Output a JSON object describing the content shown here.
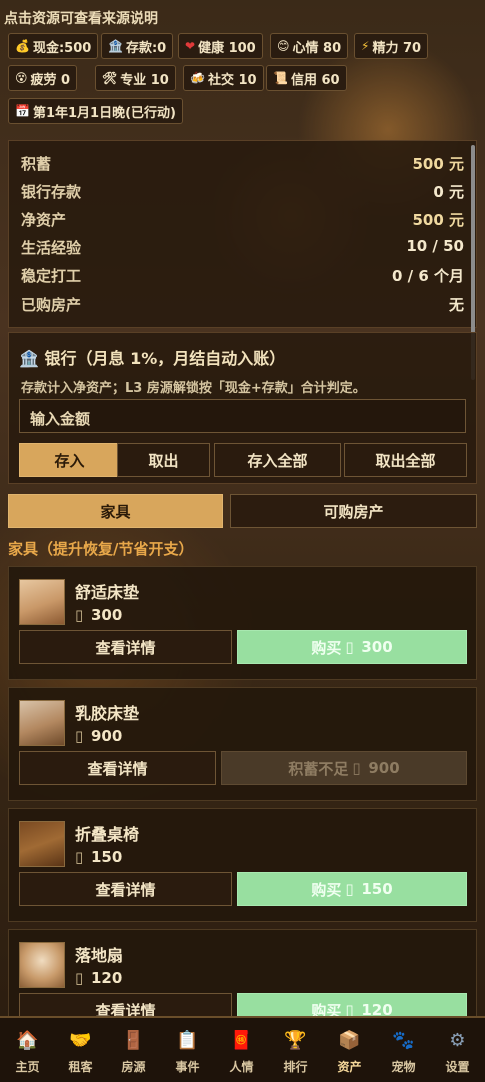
{
  "topline": "点击资源可查看来源说明",
  "stats": [
    {
      "icon": "💰",
      "label": "现金:500"
    },
    {
      "icon": "🏦",
      "label": "存款:0"
    },
    {
      "icon": "❤",
      "label": "健康 100"
    },
    {
      "icon": "😊",
      "label": "心情 80"
    },
    {
      "icon": "⚡",
      "label": "精力 70"
    },
    {
      "icon": "😵",
      "label": "疲劳 0"
    },
    {
      "icon": "🛠",
      "label": "专业 10"
    },
    {
      "icon": "🍻",
      "label": "社交 10"
    },
    {
      "icon": "📜",
      "label": "信用 60"
    },
    {
      "icon": "📅",
      "label": "第1年1月1日晚(已行动)"
    }
  ],
  "summary": [
    {
      "k": "积蓄",
      "v": "500 元"
    },
    {
      "k": "银行存款",
      "v": "0 元"
    },
    {
      "k": "净资产",
      "v": "500 元"
    },
    {
      "k": "生活经验",
      "v": "10 / 50"
    },
    {
      "k": "稳定打工",
      "v": "0 / 6 个月"
    },
    {
      "k": "已购房产",
      "v": "无"
    }
  ],
  "bank": {
    "title": "🏦 银行（月息 1%，月结自动入账）",
    "desc": "存款计入净资产；L3 房源解锁按「现金+存款」合计判定。",
    "placeholder": "输入金额",
    "buttons": [
      "存入",
      "取出",
      "存入全部",
      "取出全部"
    ]
  },
  "tabs": [
    "家具",
    "可购房产"
  ],
  "section_title": "家具（提升恢复/节省开支）",
  "items": [
    {
      "name": "舒适床垫",
      "price": "300",
      "detail": "查看详情",
      "buy": "购买",
      "buy_price": "300",
      "state": "buy"
    },
    {
      "name": "乳胶床垫",
      "price": "900",
      "detail": "查看详情",
      "buy": "积蓄不足",
      "buy_price": "900",
      "state": "disabled"
    },
    {
      "name": "折叠桌椅",
      "price": "150",
      "detail": "查看详情",
      "buy": "购买",
      "buy_price": "150",
      "state": "buy"
    },
    {
      "name": "落地扇",
      "price": "120",
      "detail": "查看详情",
      "buy": "购买",
      "buy_price": "120",
      "state": "buy"
    }
  ],
  "nav": [
    {
      "icon": "🏠",
      "label": "主页"
    },
    {
      "icon": "🤝",
      "label": "租客"
    },
    {
      "icon": "🚪",
      "label": "房源"
    },
    {
      "icon": "📋",
      "label": "事件"
    },
    {
      "icon": "🧧",
      "label": "人情"
    },
    {
      "icon": "🏆",
      "label": "排行"
    },
    {
      "icon": "📦",
      "label": "资产",
      "active": true
    },
    {
      "icon": "🐾",
      "label": "宠物"
    },
    {
      "icon": "⚙",
      "label": "设置"
    }
  ]
}
